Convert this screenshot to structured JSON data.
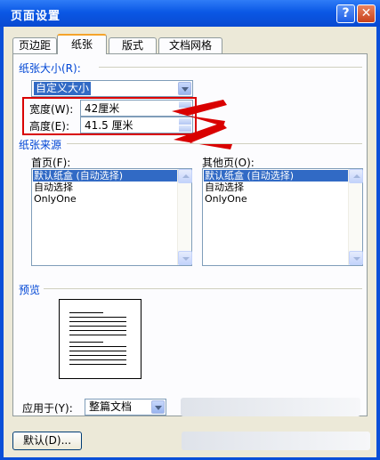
{
  "window": {
    "title": "页面设置",
    "help_glyph": "?",
    "close_glyph": "✕"
  },
  "tabs": [
    {
      "label": "页边距",
      "active": false
    },
    {
      "label": "纸张",
      "active": true
    },
    {
      "label": "版式",
      "active": false
    },
    {
      "label": "文档网格",
      "active": false
    }
  ],
  "paper_size": {
    "group_label": "纸张大小(R):",
    "selected": "自定义大小",
    "width_label": "宽度(W):",
    "width_value": "42厘米",
    "height_label": "高度(E):",
    "height_value": "41.5 厘米"
  },
  "paper_source": {
    "group_label": "纸张来源",
    "first_page_label": "首页(F):",
    "other_pages_label": "其他页(O):",
    "first_page_items": [
      "默认纸盒 (自动选择)",
      "自动选择",
      "OnlyOne"
    ],
    "other_pages_items": [
      "默认纸盒 (自动选择)",
      "自动选择",
      "OnlyOne"
    ]
  },
  "preview": {
    "group_label": "预览"
  },
  "apply_to": {
    "label": "应用于(Y):",
    "selected": "整篇文档"
  },
  "buttons": {
    "default_label": "默认(D)..."
  },
  "colors": {
    "title_blue": "#0b58e5",
    "accent_red": "#d90000",
    "selection_blue": "#316ac5",
    "group_label_blue": "#0046d5"
  }
}
